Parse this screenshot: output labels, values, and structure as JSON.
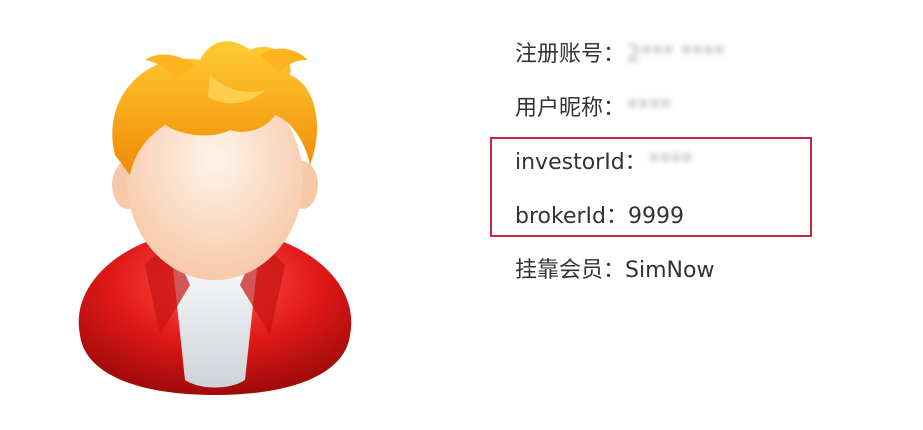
{
  "avatar": {
    "icon": "user-avatar-icon",
    "colors": {
      "hair": "#f59a0b",
      "face": "#fde0c8",
      "jacket": "#e01818",
      "shirt": "#eceef0"
    }
  },
  "account_info": {
    "registered_account": {
      "label": "注册账号：",
      "value": "2*** ****"
    },
    "nickname": {
      "label": "用户昵称：",
      "value": "****"
    },
    "investor_id": {
      "label": "investorId：",
      "value": "****"
    },
    "broker_id": {
      "label": "brokerId：",
      "value": "9999"
    },
    "member": {
      "label": "挂靠会员：",
      "value": "SimNow"
    }
  },
  "highlight": {
    "color": "#c8283c"
  }
}
